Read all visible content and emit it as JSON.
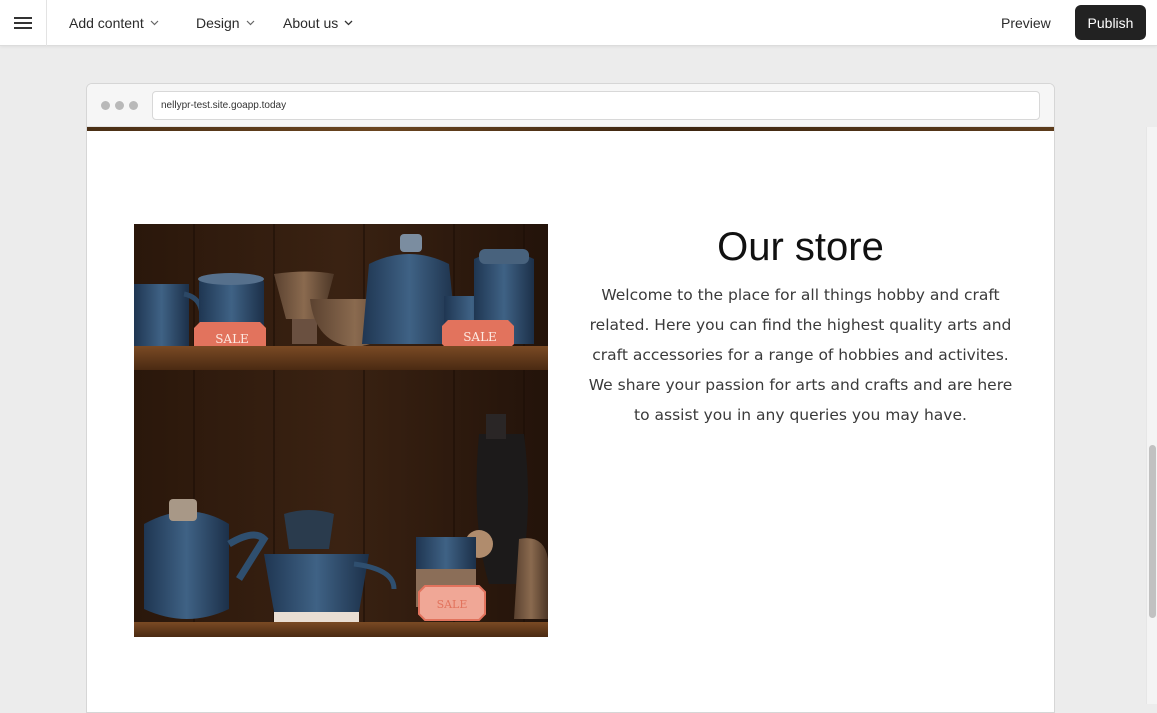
{
  "toolbar": {
    "menu_icon": "hamburger-icon",
    "nav": [
      {
        "label": "Add content"
      },
      {
        "label": "Design"
      },
      {
        "label": "About us"
      }
    ],
    "preview_label": "Preview",
    "publish_label": "Publish"
  },
  "browser": {
    "url": "nellypr-test.site.goapp.today"
  },
  "section": {
    "title": "Our store",
    "body": "Welcome to the place for all things hobby and craft related. Here you can find the highest quality arts and craft accessories for a range of hobbies and activites. We share your passion for arts and crafts and are here to assist you in any queries you may have.",
    "image": {
      "sale_tags": [
        "SALE",
        "SALE",
        "SALE"
      ]
    }
  },
  "colors": {
    "publish_bg": "#222222",
    "shelf_wood": "#5a3418",
    "pottery_blue": "#2f4f6f",
    "sale_tag": "#e2735d"
  }
}
